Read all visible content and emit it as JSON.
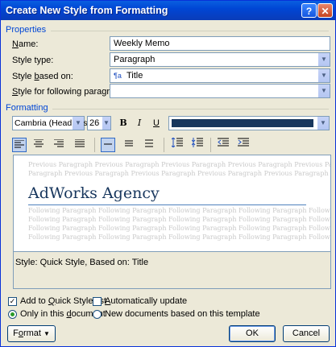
{
  "dialog": {
    "title": "Create New Style from Formatting",
    "help_label": "?",
    "close_label": "✕"
  },
  "properties": {
    "group_label": "Properties",
    "name_label": "Name:",
    "name_value": "Weekly Memo",
    "style_type_label": "Style type:",
    "style_type_value": "Paragraph",
    "style_based_on_label": "Style based on:",
    "style_based_on_value": "Title",
    "style_based_on_icon": "¶a",
    "following_label": "Style for following paragraph:",
    "following_value": ""
  },
  "formatting": {
    "group_label": "Formatting",
    "font": "Cambria (Headings)",
    "size": "26",
    "bold": "B",
    "italic": "I",
    "underline": "U",
    "font_color": "#17365d"
  },
  "preview": {
    "previous_line": "Previous Paragraph Previous Paragraph Previous Paragraph Previous Paragraph Previous Paragraph Previous Paragraph Previous",
    "previous_line2": "Paragraph Previous Paragraph Previous Paragraph Previous Paragraph Previous Paragraph",
    "sample_text": "AdWorks Agency",
    "following_line": "Following Paragraph Following Paragraph Following Paragraph Following Paragraph Following Paragraph Following Paragraph"
  },
  "description": "Style: Quick Style, Based on: Title",
  "options": {
    "add_quick_style": "Add to Quick Style list",
    "auto_update": "Automatically update",
    "only_this_doc": "Only in this document",
    "new_docs": "New documents based on this template"
  },
  "buttons": {
    "format": "Format",
    "ok": "OK",
    "cancel": "Cancel"
  }
}
